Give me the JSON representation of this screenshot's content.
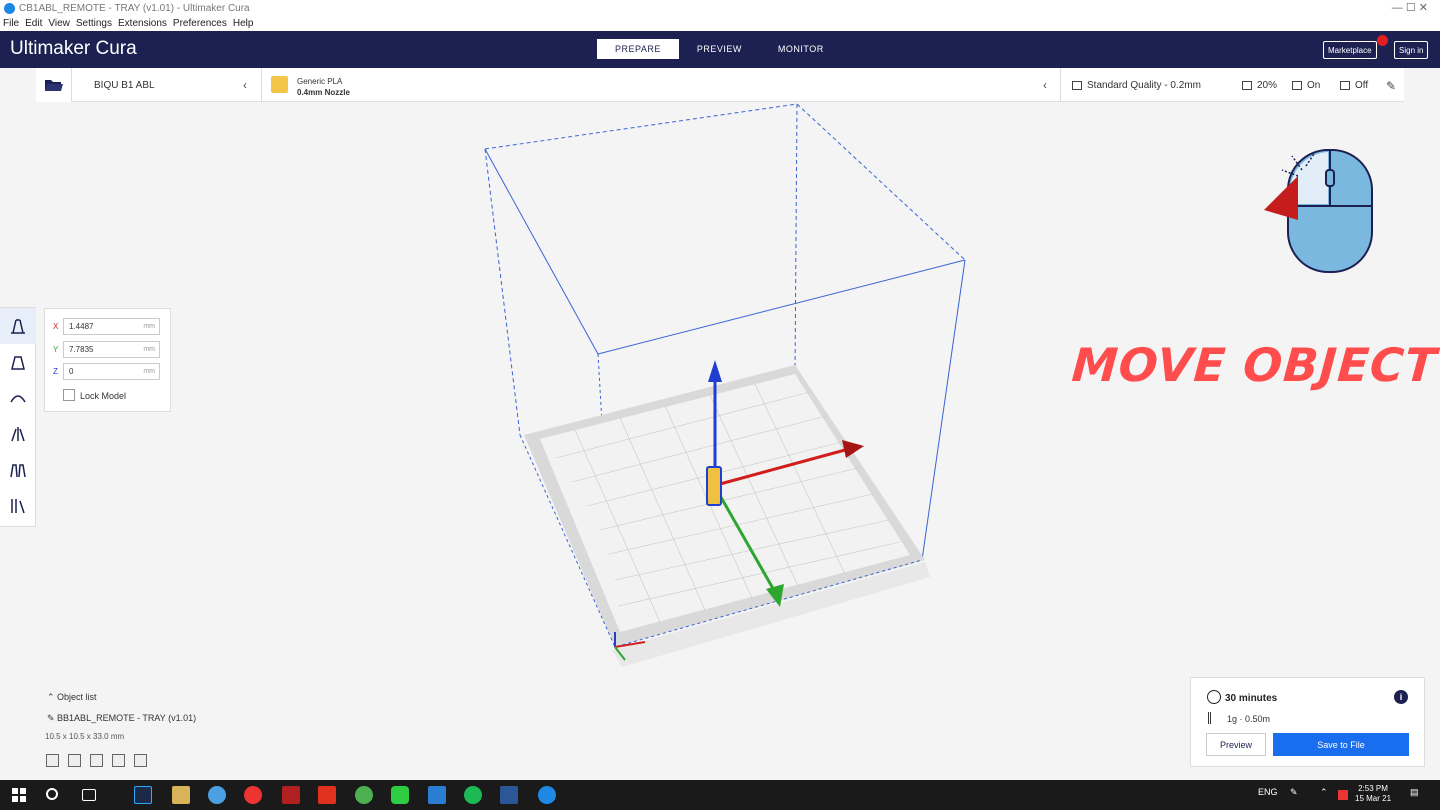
{
  "window": {
    "title": "CB1ABL_REMOTE - TRAY (v1.01) - Ultimaker Cura",
    "controls": "—   ☐   ✕"
  },
  "menu": [
    "File",
    "Edit",
    "View",
    "Settings",
    "Extensions",
    "Preferences",
    "Help"
  ],
  "header": {
    "brand": "Ultimaker Cura",
    "stages": [
      "PREPARE",
      "PREVIEW",
      "MONITOR"
    ],
    "active_stage": "PREPARE",
    "marketplace": "Marketplace",
    "sign_in": "Sign in"
  },
  "config": {
    "printer": "BIQU B1 ABL",
    "material_name": "Generic PLA",
    "nozzle": "0.4mm Nozzle",
    "quality": "Standard Quality - 0.2mm",
    "infill": "20%",
    "support": "On",
    "adhesion": "Off"
  },
  "move_panel": {
    "x_label": "X",
    "x_value": "1.4487",
    "y_label": "Y",
    "y_value": "7.7835",
    "z_label": "Z",
    "z_value": "0",
    "unit": "mm",
    "lock_label": "Lock Model"
  },
  "banner": "MOVE OBJECT",
  "object_list": {
    "header": "Object list",
    "name": "BB1ABL_REMOTE - TRAY (v1.01)",
    "dims": "10.5 x 10.5 x 33.0 mm"
  },
  "print": {
    "time": "30 minutes",
    "material": "1g · 0.50m",
    "preview_label": "Preview",
    "save_label": "Save to File"
  },
  "taskbar": {
    "lang": "ENG",
    "time": "2:53 PM",
    "date": "15 Mar 21"
  },
  "colors": {
    "header_bg": "#1c2151",
    "save_button": "#196ef0",
    "banner": "#ff4d4d",
    "axis_x": "#d21d1d",
    "axis_y": "#2ea52e",
    "axis_z": "#1f3fd0"
  }
}
